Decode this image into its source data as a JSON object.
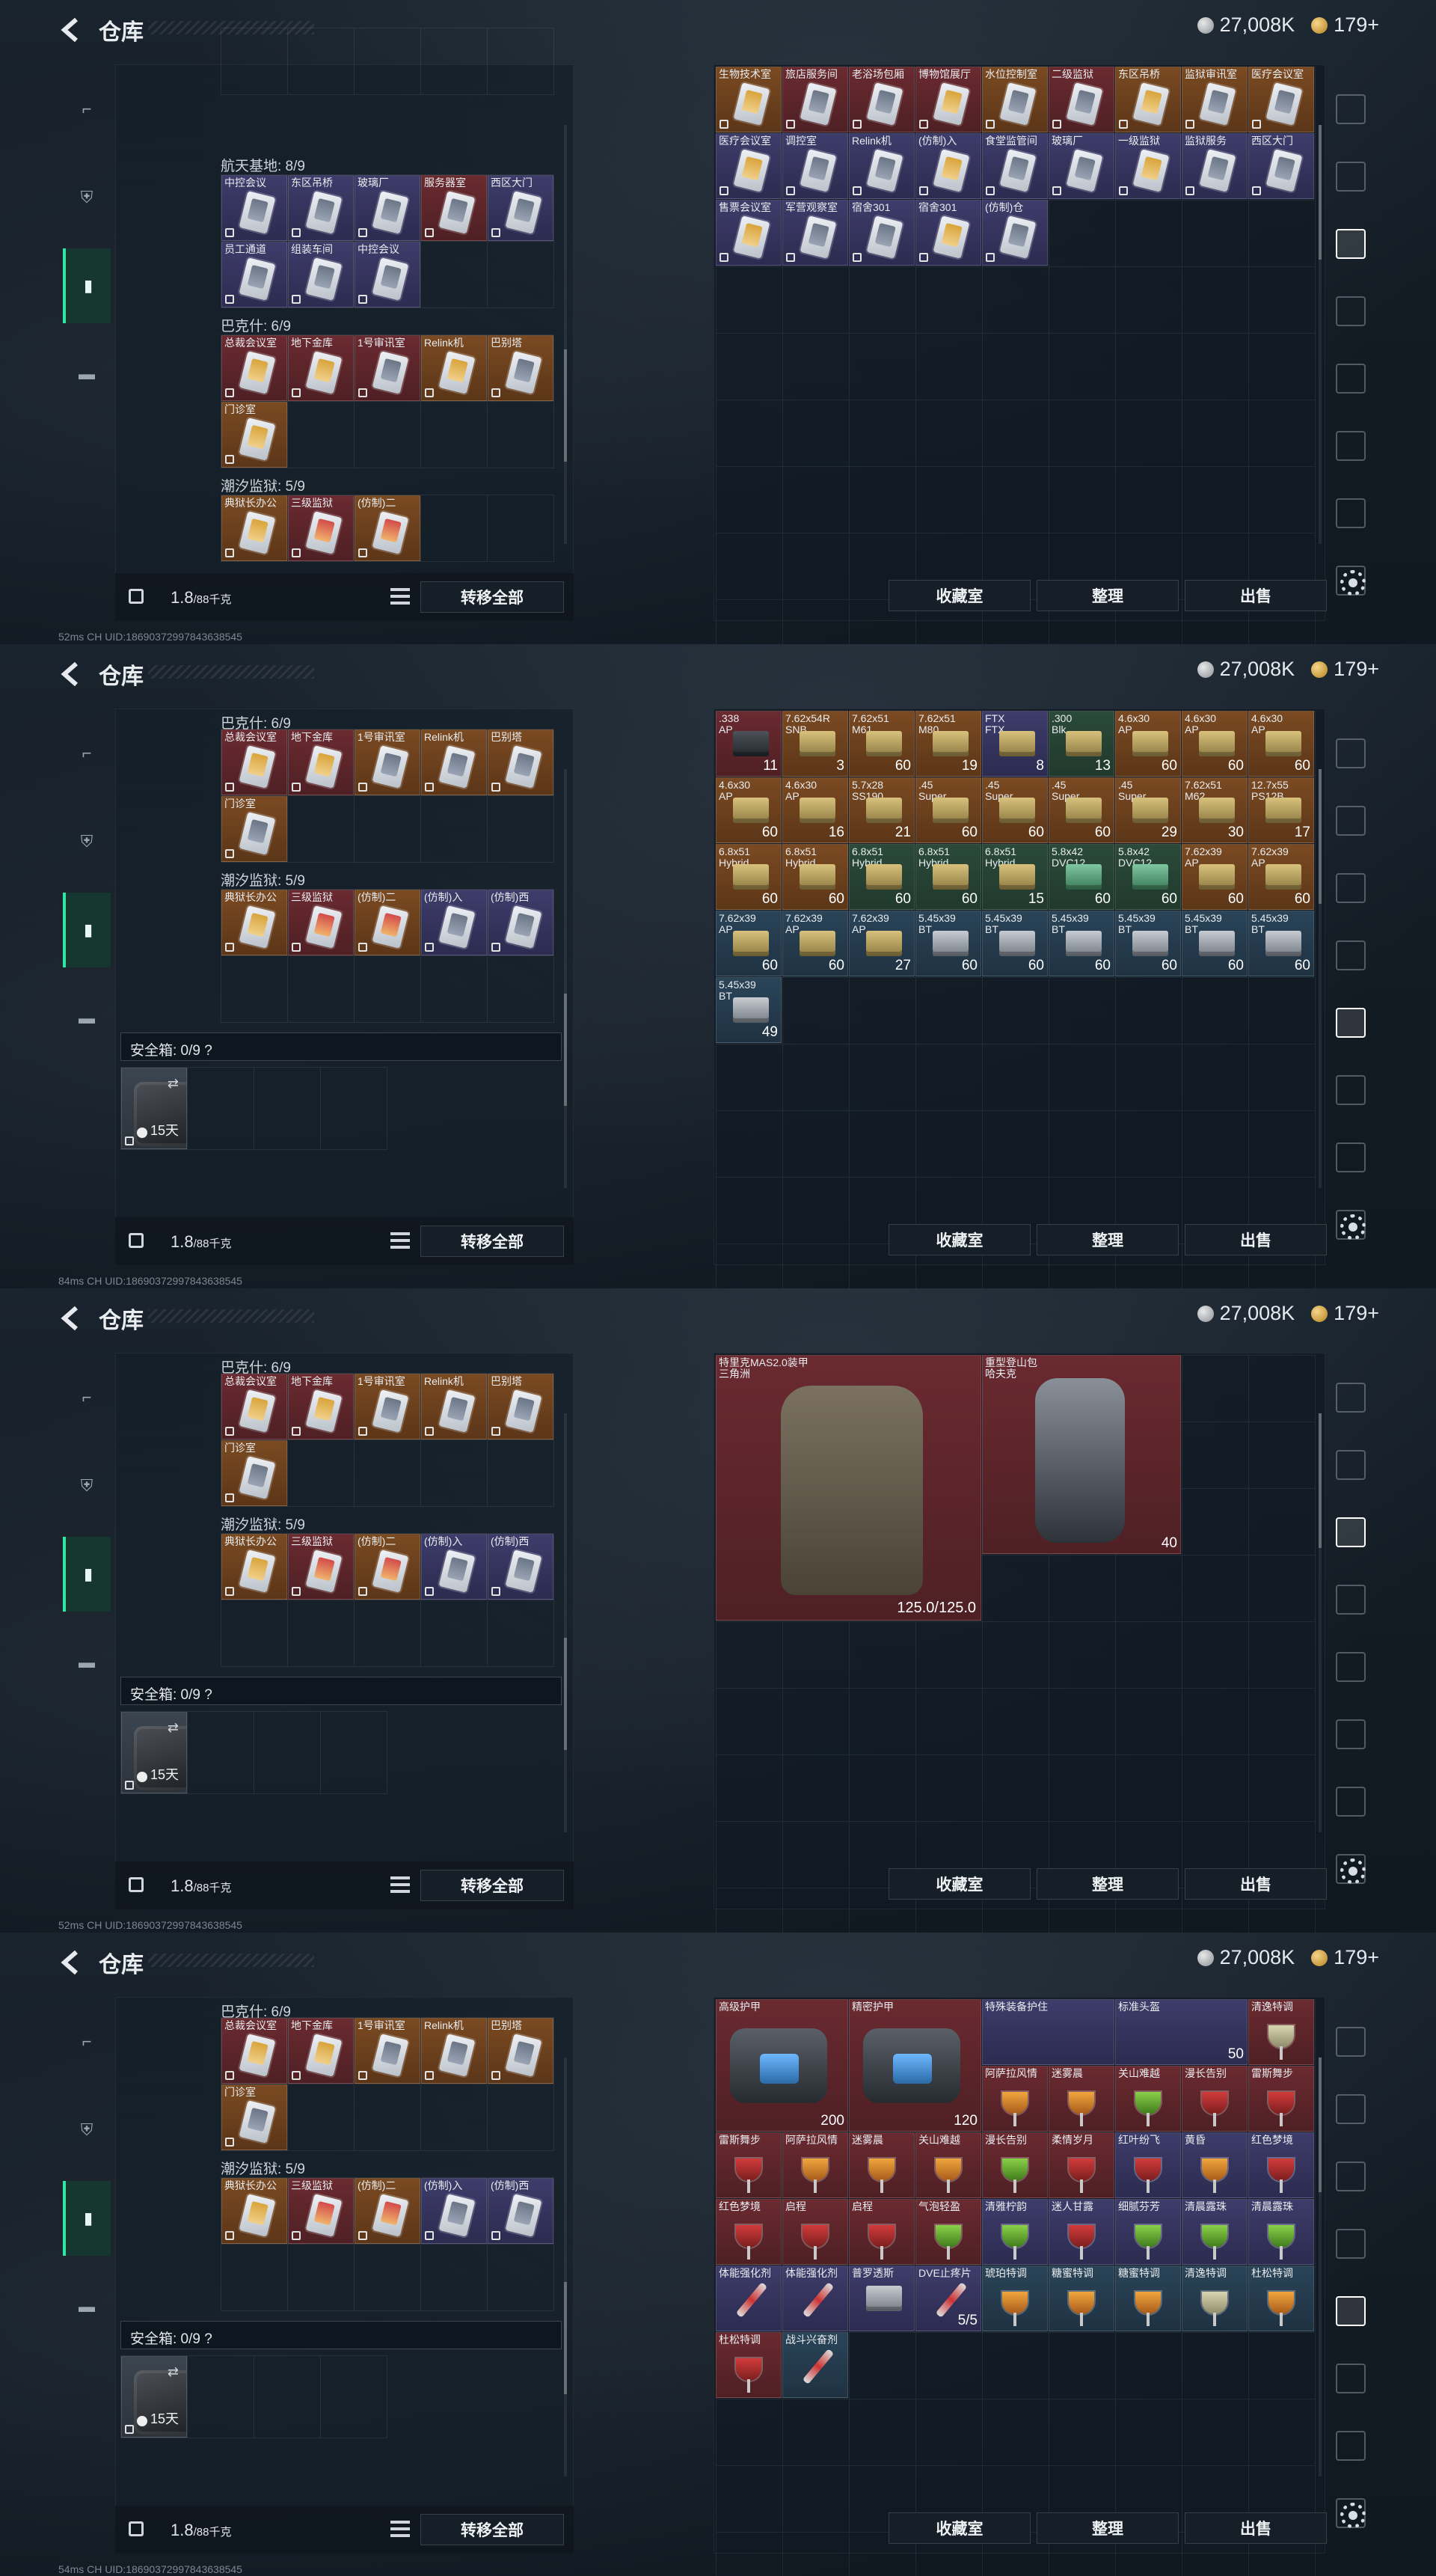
{
  "app": {
    "title": "仓库",
    "currency": [
      {
        "name": "silver-coin-icon",
        "value": "27,008K"
      },
      {
        "name": "gold-coin-icon",
        "value": "179+"
      }
    ]
  },
  "bottom_bar": {
    "weight": "1.8",
    "weight_unit": "/88千克",
    "transfer_all": "转移全部"
  },
  "actions": {
    "collection": "收藏室",
    "organize": "整理",
    "sell": "出售"
  },
  "safe_box": {
    "label": "安全箱: 0/9 ?",
    "timer": "15天"
  },
  "statusbar": [
    {
      "ping": "52ms",
      "uid": "CH UID:18690372997843638545"
    },
    {
      "ping": "84ms",
      "uid": "CH UID:18690372997843638545"
    },
    {
      "ping": "52ms",
      "uid": "CH UID:18690372997843638545"
    },
    {
      "ping": "54ms",
      "uid": "CH UID:18690372997843638545"
    }
  ],
  "sections": {
    "aerospace": {
      "name": "航天基地: 8/9",
      "items": [
        "中控会议",
        "东区吊桥",
        "玻璃厂",
        "服务器室",
        "西区大门",
        "员工通道",
        "组装车间",
        "中控会议"
      ]
    },
    "bakeshi": {
      "name": "巴克什: 6/9",
      "items": [
        "总裁会议室",
        "地下金库",
        "1号审讯室",
        "Relink机",
        "巴别塔",
        "门诊室"
      ]
    },
    "chaoxi": {
      "name": "潮汐监狱: 5/9",
      "items": [
        "典狱长办公",
        "三级监狱",
        "(仿制)二",
        "(仿制)入",
        "(仿制)西"
      ]
    }
  },
  "screen1_right": [
    "生物技术室",
    "旅店服务间",
    "老浴场包厢",
    "博物馆展厅",
    "水位控制室",
    "二级监狱",
    "东区吊桥",
    "监狱审讯室",
    "医疗会议室",
    "医疗会议室",
    "调控室",
    "Relink机",
    "(仿制)入",
    "食堂监管间",
    "玻璃厂",
    "一级监狱",
    "监狱服务",
    "西区大门",
    "售票会议室",
    "军营观察室",
    "宿舍301",
    "宿舍301",
    "(仿制)仓"
  ],
  "screen2_ammo": [
    {
      "n1": ".338",
      "n2": "AP",
      "c": "11"
    },
    {
      "n1": "7.62x54R",
      "n2": "SNB",
      "c": "3"
    },
    {
      "n1": "7.62x51",
      "n2": "M61",
      "c": "60"
    },
    {
      "n1": "7.62x51",
      "n2": "M80",
      "c": "19"
    },
    {
      "n1": "FTX",
      "n2": "FTX",
      "c": "8"
    },
    {
      "n1": ".300",
      "n2": "Blk",
      "c": "13"
    },
    {
      "n1": "4.6x30",
      "n2": "AP",
      "c": "60"
    },
    {
      "n1": "4.6x30",
      "n2": "AP",
      "c": "60"
    },
    {
      "n1": "4.6x30",
      "n2": "AP",
      "c": "60"
    },
    {
      "n1": "4.6x30",
      "n2": "AP",
      "c": "60"
    },
    {
      "n1": "4.6x30",
      "n2": "AP",
      "c": "16"
    },
    {
      "n1": "5.7x28",
      "n2": "SS190",
      "c": "21"
    },
    {
      "n1": ".45",
      "n2": "Super",
      "c": "60"
    },
    {
      "n1": ".45",
      "n2": "Super",
      "c": "60"
    },
    {
      "n1": ".45",
      "n2": "Super",
      "c": "60"
    },
    {
      "n1": ".45",
      "n2": "Super",
      "c": "29"
    },
    {
      "n1": "7.62x51",
      "n2": "M62",
      "c": "30"
    },
    {
      "n1": "12.7x55",
      "n2": "PS12B",
      "c": "17"
    },
    {
      "n1": "6.8x51",
      "n2": "Hybrid",
      "c": "60"
    },
    {
      "n1": "6.8x51",
      "n2": "Hybrid",
      "c": "60"
    },
    {
      "n1": "6.8x51",
      "n2": "Hybrid",
      "c": "60"
    },
    {
      "n1": "6.8x51",
      "n2": "Hybrid",
      "c": "60"
    },
    {
      "n1": "6.8x51",
      "n2": "Hybrid",
      "c": "15"
    },
    {
      "n1": "5.8x42",
      "n2": "DVC12",
      "c": "60"
    },
    {
      "n1": "5.8x42",
      "n2": "DVC12",
      "c": "60"
    },
    {
      "n1": "7.62x39",
      "n2": "AP",
      "c": "60"
    },
    {
      "n1": "7.62x39",
      "n2": "AP",
      "c": "60"
    },
    {
      "n1": "7.62x39",
      "n2": "AP",
      "c": "60"
    },
    {
      "n1": "7.62x39",
      "n2": "AP",
      "c": "60"
    },
    {
      "n1": "7.62x39",
      "n2": "AP",
      "c": "27"
    },
    {
      "n1": "5.45x39",
      "n2": "BT",
      "c": "60"
    },
    {
      "n1": "5.45x39",
      "n2": "BT",
      "c": "60"
    },
    {
      "n1": "5.45x39",
      "n2": "BT",
      "c": "60"
    },
    {
      "n1": "5.45x39",
      "n2": "BT",
      "c": "60"
    },
    {
      "n1": "5.45x39",
      "n2": "BT",
      "c": "60"
    },
    {
      "n1": "5.45x39",
      "n2": "BT",
      "c": "60"
    },
    {
      "n1": "5.45x39",
      "n2": "BT",
      "c": "49"
    }
  ],
  "screen3_gear": [
    {
      "name": "特里克MAS2.0装甲",
      "sub": "三角洲",
      "value": "125.0/125.0"
    },
    {
      "name": "重型登山包",
      "sub": "哈夫克",
      "value": "40"
    }
  ],
  "screen4_items": [
    {
      "n": "高级护甲",
      "c": "200"
    },
    {
      "n": "精密护甲",
      "c": "120"
    },
    {
      "n": "特殊装备护住",
      "c": ""
    },
    {
      "n": "标准头盔",
      "c": "50"
    },
    {
      "n": "清逸特调",
      "c": ""
    },
    {
      "n": "阿萨拉风情",
      "c": ""
    },
    {
      "n": "迷雾晨",
      "c": ""
    },
    {
      "n": "关山难越",
      "c": ""
    },
    {
      "n": "漫长告别",
      "c": ""
    },
    {
      "n": "雷斯舞步",
      "c": ""
    },
    {
      "n": "雷斯舞步",
      "c": ""
    },
    {
      "n": "阿萨拉风情",
      "c": ""
    },
    {
      "n": "迷雾晨",
      "c": ""
    },
    {
      "n": "关山难越",
      "c": ""
    },
    {
      "n": "漫长告别",
      "c": ""
    },
    {
      "n": "柔情岁月",
      "c": ""
    },
    {
      "n": "红叶纷飞",
      "c": ""
    },
    {
      "n": "黄昏",
      "c": ""
    },
    {
      "n": "红色梦境",
      "c": ""
    },
    {
      "n": "红色梦境",
      "c": ""
    },
    {
      "n": "启程",
      "c": ""
    },
    {
      "n": "启程",
      "c": ""
    },
    {
      "n": "气泡轻盈",
      "c": ""
    },
    {
      "n": "清雅柠韵",
      "c": ""
    },
    {
      "n": "迷人甘露",
      "c": ""
    },
    {
      "n": "细腻芬芳",
      "c": ""
    },
    {
      "n": "清晨露珠",
      "c": ""
    },
    {
      "n": "清晨露珠",
      "c": ""
    },
    {
      "n": "体能强化剂",
      "c": ""
    },
    {
      "n": "体能强化剂",
      "c": ""
    },
    {
      "n": "普罗透斯",
      "c": ""
    },
    {
      "n": "DVE止疼片",
      "c": "5/5"
    },
    {
      "n": "琥珀特调",
      "c": ""
    },
    {
      "n": "糖蜜特调",
      "c": ""
    },
    {
      "n": "糖蜜特调",
      "c": ""
    },
    {
      "n": "清逸特调",
      "c": ""
    },
    {
      "n": "杜松特调",
      "c": ""
    },
    {
      "n": "杜松特调",
      "c": ""
    },
    {
      "n": "战斗兴奋剂",
      "c": ""
    }
  ]
}
